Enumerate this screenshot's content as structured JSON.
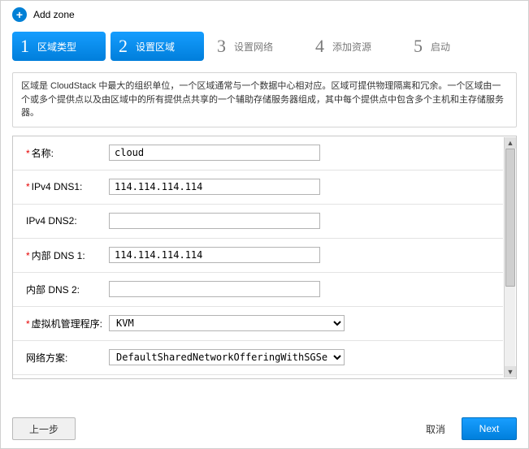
{
  "header": {
    "title": "Add zone"
  },
  "steps": [
    {
      "num": "1",
      "label": "区域类型"
    },
    {
      "num": "2",
      "label": "设置区域"
    },
    {
      "num": "3",
      "label": "设置网络"
    },
    {
      "num": "4",
      "label": "添加资源"
    },
    {
      "num": "5",
      "label": "启动"
    }
  ],
  "description": "区域是 CloudStack 中最大的组织单位，一个区域通常与一个数据中心相对应。区域可提供物理隔离和冗余。一个区域由一个或多个提供点以及由区域中的所有提供点共享的一个辅助存储服务器组成，其中每个提供点中包含多个主机和主存储服务器。",
  "fields": {
    "name_label": "名称:",
    "name_value": "cloud",
    "dns1_label": "IPv4 DNS1:",
    "dns1_value": "114.114.114.114",
    "dns2_label": "IPv4 DNS2:",
    "dns2_value": "",
    "idns1_label": "内部 DNS 1:",
    "idns1_value": "114.114.114.114",
    "idns2_label": "内部 DNS 2:",
    "idns2_value": "",
    "hypervisor_label": "虚拟机管理程序:",
    "hypervisor_value": "KVM",
    "network_label": "网络方案:",
    "network_value": "DefaultSharedNetworkOfferingWithSGService"
  },
  "footer": {
    "prev": "上一步",
    "cancel": "取消",
    "next": "Next"
  }
}
